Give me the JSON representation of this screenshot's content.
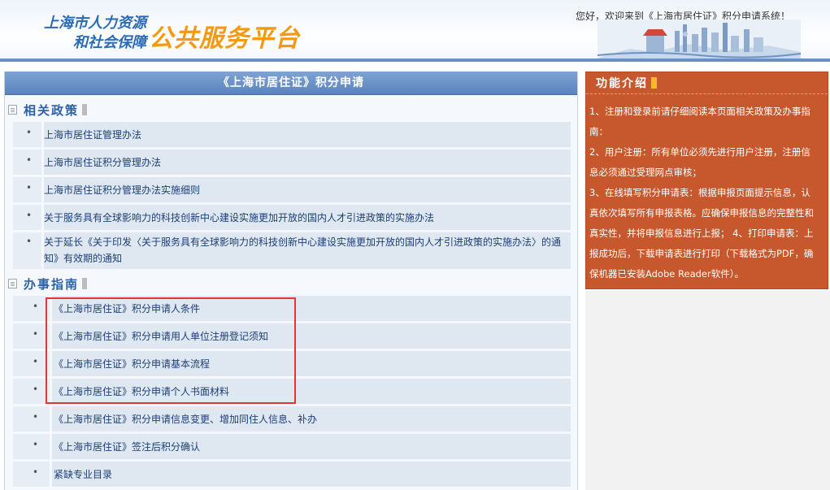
{
  "header": {
    "logo_line1": "上海市人力资源",
    "logo_line2": "和社会保障",
    "logo_main": "公共服务平台",
    "welcome": "您好，欢迎来到《上海市居住证》积分申请系统！"
  },
  "main": {
    "title": "《上海市居住证》积分申请",
    "policy_section": {
      "heading": "相关政策",
      "items": [
        "上海市居住证管理办法",
        "上海市居住证积分管理办法",
        "上海市居住证积分管理办法实施细则",
        "关于服务具有全球影响力的科技创新中心建设实施更加开放的国内人才引进政策的实施办法",
        "关于延长《关于印发〈关于服务具有全球影响力的科技创新中心建设实施更加开放的国内人才引进政策的实施办法〉的通",
        "知》有效期的通知"
      ]
    },
    "guide_section": {
      "heading": "办事指南",
      "items": [
        "《上海市居住证》积分申请人条件",
        "《上海市居住证》积分申请用人单位注册登记须知",
        "《上海市居住证》积分申请基本流程",
        "《上海市居住证》积分申请个人书面材料",
        "《上海市居住证》积分申请信息变更、增加同住人信息、补办",
        "《上海市居住证》签注后积分确认",
        "紧缺专业目录"
      ]
    },
    "bullet": "•"
  },
  "side": {
    "title": "功能介绍",
    "lines": [
      "1、注册和登录前请仔细阅读本页面相关政策及办事指",
      "南：",
      "2、用户注册：所有单位必须先进行用户注册，注册信",
      "息必须通过受理网点审核；",
      "3、在线填写积分申请表：根据申报页面提示信息，认",
      "真依次填写所有申报表格。应确保申报信息的完整性和",
      "真实性，并将申报信息进行上报；  4、打印申请表：上",
      "报成功后，下载申请表进行打印（下载格式为PDF，确",
      "保机器已安装Adobe Reader软件）。"
    ]
  },
  "colors": {
    "accent_blue": "#2d62a6",
    "title_bar": "#5b83bd",
    "side_panel": "#c7582e",
    "highlight_box": "#e0363a",
    "logo_orange": "#f39a14"
  }
}
